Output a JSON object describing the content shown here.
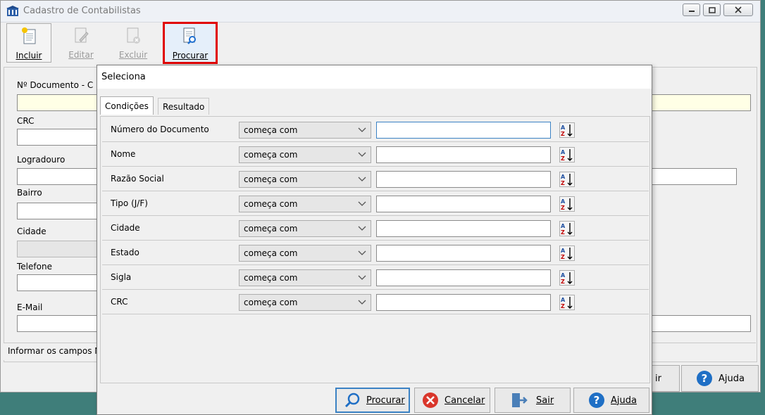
{
  "window": {
    "title": "Cadastro de Contabilistas"
  },
  "toolbar": {
    "incluir": "Incluir",
    "editar": "Editar",
    "excluir": "Excluir",
    "procurar": "Procurar"
  },
  "form": {
    "doc_label": "Nº Documento - C",
    "crc_label": "CRC",
    "logradouro_label": "Logradouro",
    "bairro_label": "Bairro",
    "cidade_label": "Cidade",
    "telefone_label": "Telefone",
    "email_label": "E-Mail",
    "status": "Informar os campos N",
    "btn_partial": "ir",
    "btn_ajuda": "Ajuda"
  },
  "dialog": {
    "title": "Seleciona",
    "tabs": [
      "Condições",
      "Resultado"
    ],
    "operator": "começa com",
    "rows": [
      {
        "field": "Número do Documento"
      },
      {
        "field": "Nome"
      },
      {
        "field": "Razão Social"
      },
      {
        "field": "Tipo (J/F)"
      },
      {
        "field": "Cidade"
      },
      {
        "field": "Estado"
      },
      {
        "field": "Sigla"
      },
      {
        "field": "CRC"
      }
    ],
    "buttons": {
      "procurar": "Procurar",
      "cancelar": "Cancelar",
      "sair": "Sair",
      "ajuda": "Ajuda"
    }
  },
  "colors": {
    "desktop": "#3f7e7a",
    "highlight": "#e00000",
    "focus": "#3b82c4"
  }
}
